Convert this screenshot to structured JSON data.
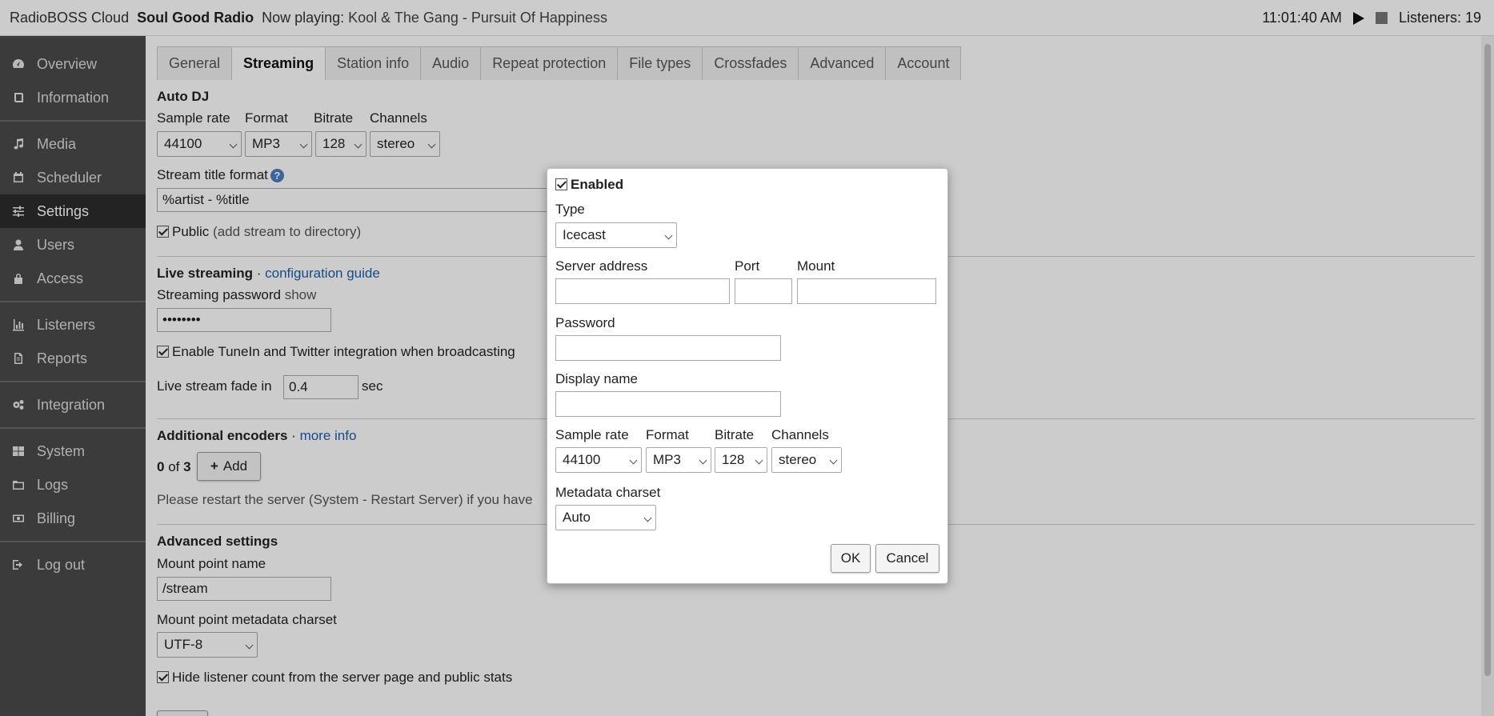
{
  "topbar": {
    "app_name": "RadioBOSS Cloud",
    "station": "Soul Good Radio",
    "now_playing_label": "Now playing:",
    "now_playing_track": "Kool & The Gang - Pursuit Of Happiness",
    "time": "11:01:40 AM",
    "listeners": "Listeners: 19"
  },
  "sidebar": {
    "items": [
      {
        "label": "Overview",
        "icon": "gauge-icon"
      },
      {
        "label": "Information",
        "icon": "book-icon"
      },
      {
        "label": "Media",
        "icon": "music-note-icon"
      },
      {
        "label": "Scheduler",
        "icon": "calendar-icon"
      },
      {
        "label": "Settings",
        "icon": "sliders-icon"
      },
      {
        "label": "Users",
        "icon": "user-icon"
      },
      {
        "label": "Access",
        "icon": "lock-icon"
      },
      {
        "label": "Listeners",
        "icon": "bar-chart-icon"
      },
      {
        "label": "Reports",
        "icon": "document-icon"
      },
      {
        "label": "Integration",
        "icon": "gears-icon"
      },
      {
        "label": "System",
        "icon": "grid-icon"
      },
      {
        "label": "Logs",
        "icon": "folder-icon"
      },
      {
        "label": "Billing",
        "icon": "money-icon"
      },
      {
        "label": "Log out",
        "icon": "logout-icon"
      }
    ]
  },
  "tabs": [
    "General",
    "Streaming",
    "Station info",
    "Audio",
    "Repeat protection",
    "File types",
    "Crossfades",
    "Advanced",
    "Account"
  ],
  "autodj": {
    "heading": "Auto DJ",
    "sample_rate_label": "Sample rate",
    "format_label": "Format",
    "bitrate_label": "Bitrate",
    "channels_label": "Channels",
    "sample_rate": "44100",
    "format": "MP3",
    "bitrate": "128",
    "channels": "stereo",
    "title_format_label": "Stream title format",
    "title_format": "%artist - %title",
    "public_label": "Public",
    "public_hint": "(add stream to directory)"
  },
  "live": {
    "heading": "Live streaming",
    "sep": "·",
    "guide_link": "configuration guide",
    "password_label": "Streaming password",
    "show_link": "show",
    "password_mask": "••••••••",
    "tunein_label": "Enable TuneIn and Twitter integration when broadcasting",
    "fade_label": "Live stream fade in",
    "fade_value": "0.4",
    "fade_unit": "sec"
  },
  "encoders": {
    "heading": "Additional encoders",
    "sep": "·",
    "more_link": "more info",
    "count_current": "0",
    "count_of": "of",
    "count_max": "3",
    "add_label": "Add",
    "restart_note": "Please restart the server (System - Restart Server) if you have"
  },
  "advanced": {
    "heading": "Advanced settings",
    "mount_label": "Mount point name",
    "mount_value": "/stream",
    "charset_label": "Mount point metadata charset",
    "charset_value": "UTF-8",
    "hide_label": "Hide listener count from the server page and public stats"
  },
  "modal": {
    "enabled_label": "Enabled",
    "type_label": "Type",
    "type_value": "Icecast",
    "server_label": "Server address",
    "port_label": "Port",
    "mount_label": "Mount",
    "password_label": "Password",
    "display_label": "Display name",
    "sample_rate_label": "Sample rate",
    "format_label": "Format",
    "bitrate_label": "Bitrate",
    "channels_label": "Channels",
    "sample_rate": "44100",
    "format": "MP3",
    "bitrate": "128",
    "channels": "stereo",
    "charset_label": "Metadata charset",
    "charset_value": "Auto",
    "ok_label": "OK",
    "cancel_label": "Cancel"
  }
}
